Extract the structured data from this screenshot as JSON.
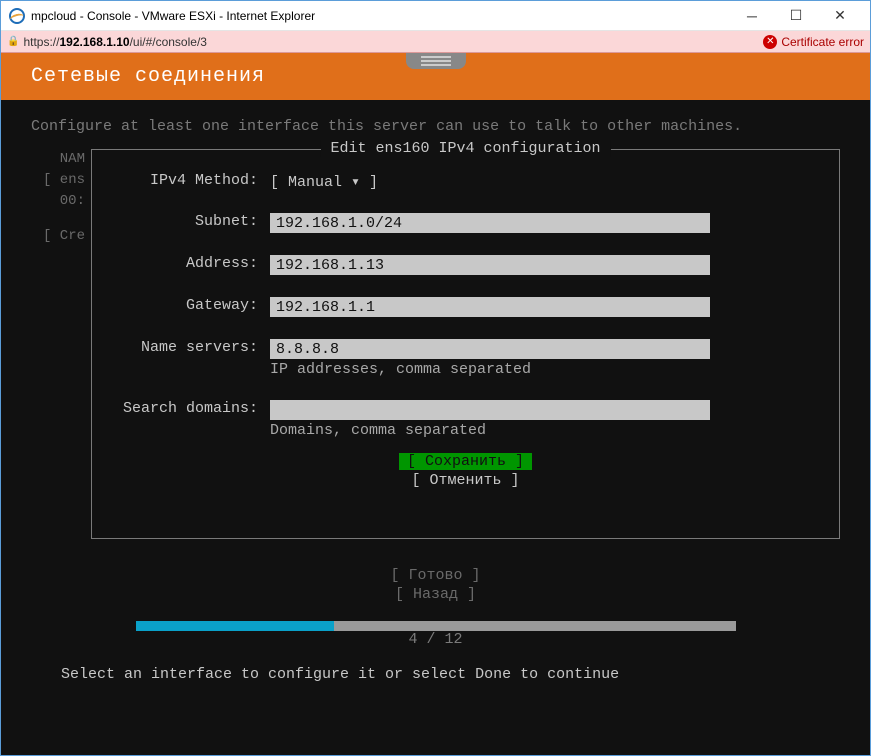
{
  "window": {
    "title": "mpcloud - Console - VMware ESXi - Internet Explorer",
    "url_prefix": "https://",
    "url_host": "192.168.1.10",
    "url_path": "/ui/#/console/3",
    "cert_error": "Certificate error"
  },
  "header": {
    "title": "Сетевые соединения"
  },
  "hint_top": "Configure at least one interface this server can use to talk to other machines.",
  "left_column": {
    "l1": "NAM",
    "l2": "[ ens",
    "l3": "00:",
    "l4": "[ Cre"
  },
  "dialog": {
    "title": "Edit ens160 IPv4 configuration",
    "method_label": "IPv4 Method:",
    "method_value": "[ Manual            ▾ ]",
    "subnet_label": "Subnet:",
    "subnet_value": "192.168.1.0/24",
    "address_label": "Address:",
    "address_value": "192.168.1.13",
    "gateway_label": "Gateway:",
    "gateway_value": "192.168.1.1",
    "ns_label": "Name servers:",
    "ns_value": "8.8.8.8",
    "ns_hint": "IP addresses, comma separated",
    "sd_label": "Search domains:",
    "sd_value": "",
    "sd_hint": "Domains, comma separated",
    "btn_save": "[ Сохранить ]",
    "btn_cancel": "[ Отменить  ]"
  },
  "below": {
    "ready": "[ Готово     ]",
    "back": "[ Назад      ]"
  },
  "progress": {
    "text": "4 / 12",
    "percent": 33
  },
  "hint_bottom": "Select an interface to configure it or select Done to continue"
}
